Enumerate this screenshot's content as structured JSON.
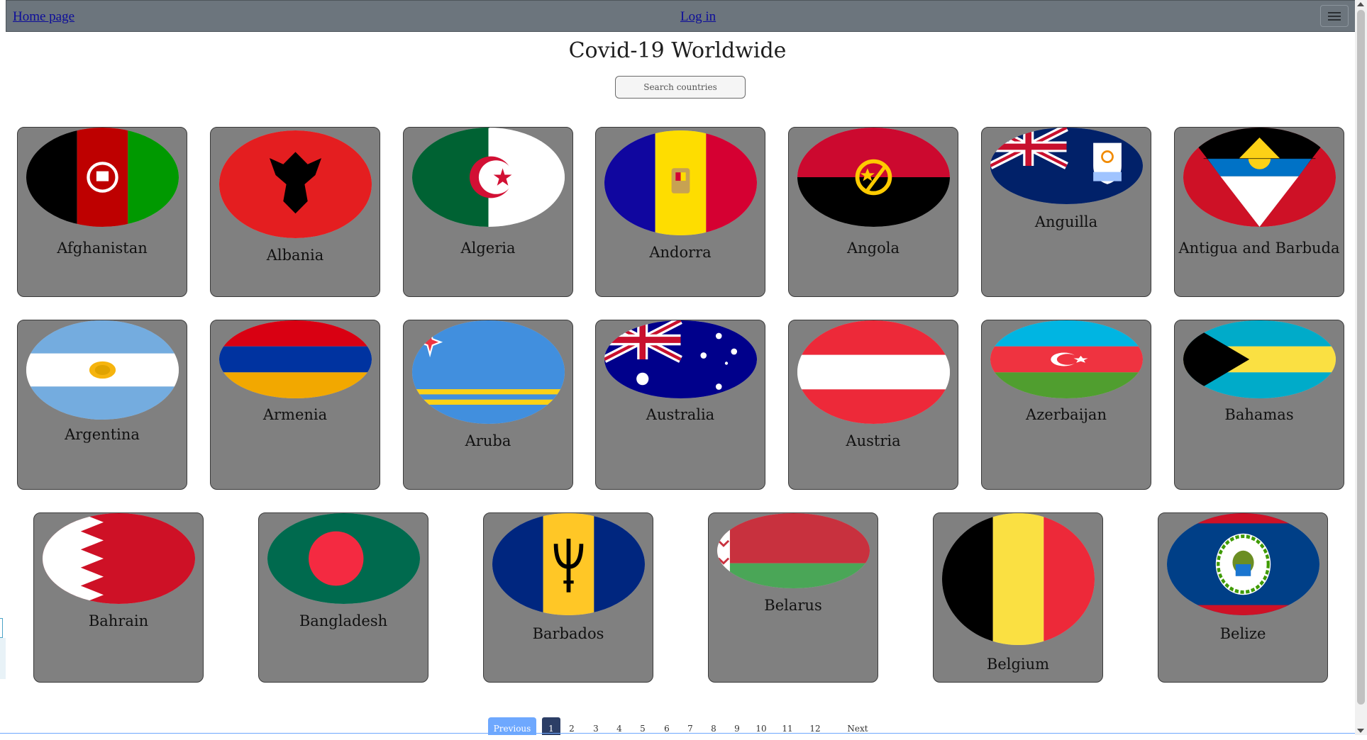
{
  "nav": {
    "home_label": "Home page",
    "login_label": "Log in",
    "menu_icon": "hamburger-menu-icon"
  },
  "page": {
    "title": "Covid-19 Worldwide",
    "search_placeholder": "Search countries"
  },
  "countries": [
    {
      "name": "Afghanistan"
    },
    {
      "name": "Albania"
    },
    {
      "name": "Algeria"
    },
    {
      "name": "Andorra"
    },
    {
      "name": "Angola"
    },
    {
      "name": "Anguilla"
    },
    {
      "name": "Antigua and Barbuda"
    },
    {
      "name": "Argentina"
    },
    {
      "name": "Armenia"
    },
    {
      "name": "Aruba"
    },
    {
      "name": "Australia"
    },
    {
      "name": "Austria"
    },
    {
      "name": "Azerbaijan"
    },
    {
      "name": "Bahamas"
    },
    {
      "name": "Bahrain"
    },
    {
      "name": "Bangladesh"
    },
    {
      "name": "Barbados"
    },
    {
      "name": "Belarus"
    },
    {
      "name": "Belgium"
    },
    {
      "name": "Belize"
    }
  ],
  "pagination": {
    "previous_label": "Previous",
    "next_label": "Next",
    "pages": [
      "1",
      "2",
      "3",
      "4",
      "5",
      "6",
      "7",
      "8",
      "9",
      "10",
      "11",
      "12"
    ],
    "current_page": "1"
  },
  "colors": {
    "navbar": "#6c757d",
    "card": "#808080",
    "link": "#0d0d9a",
    "pagination_active": "#2c3e66",
    "pagination_prev": "#6ea8fe"
  }
}
